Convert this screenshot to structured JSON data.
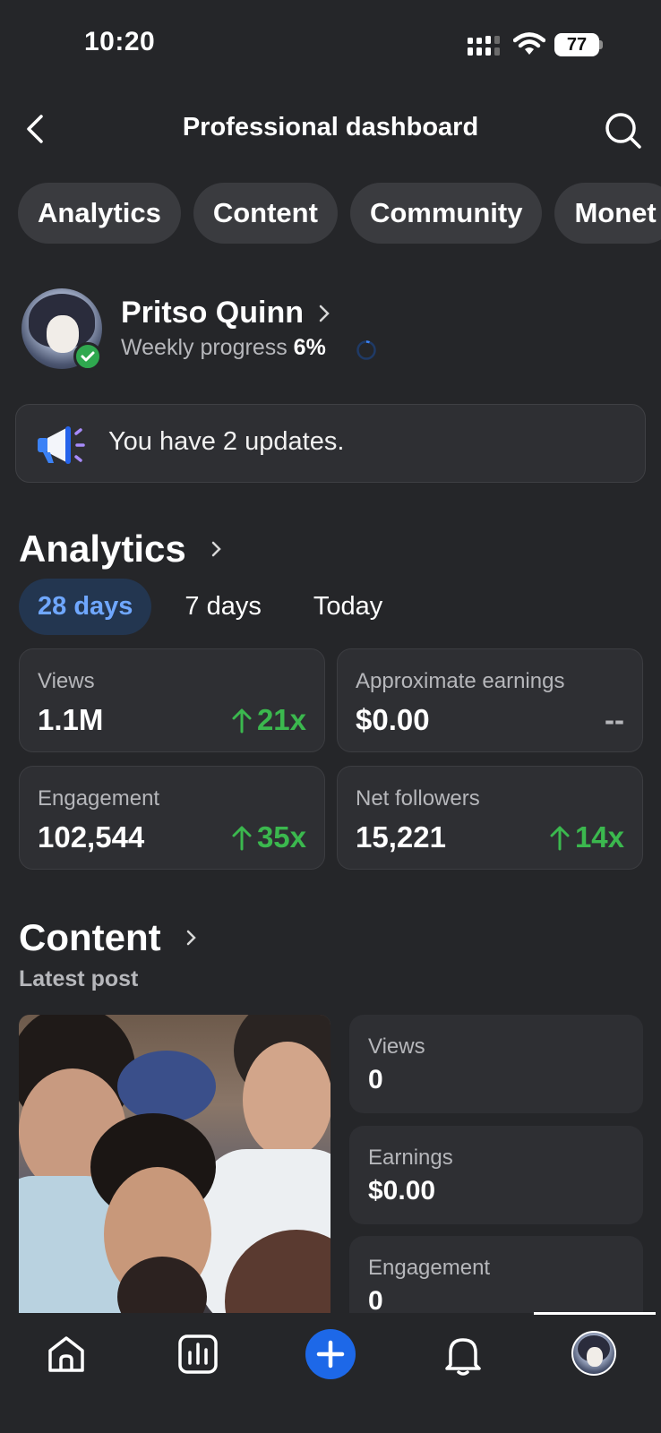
{
  "status_bar": {
    "time": "10:20",
    "battery": "77"
  },
  "header": {
    "title": "Professional dashboard"
  },
  "tabs": [
    {
      "label": "Analytics"
    },
    {
      "label": "Content"
    },
    {
      "label": "Community"
    },
    {
      "label": "Monet"
    }
  ],
  "profile": {
    "name": "Pritso Quinn",
    "progress_label": "Weekly progress",
    "progress_value": "6%"
  },
  "banner": {
    "text": "You have 2 updates."
  },
  "analytics": {
    "title": "Analytics",
    "ranges": [
      {
        "label": "28 days",
        "active": true
      },
      {
        "label": "7 days",
        "active": false
      },
      {
        "label": "Today",
        "active": false
      }
    ],
    "cards": [
      {
        "label": "Views",
        "value": "1.1M",
        "delta": "21x"
      },
      {
        "label": "Approximate earnings",
        "value": "$0.00",
        "delta": "--"
      },
      {
        "label": "Engagement",
        "value": "102,544",
        "delta": "35x"
      },
      {
        "label": "Net followers",
        "value": "15,221",
        "delta": "14x"
      }
    ]
  },
  "content": {
    "title": "Content",
    "subtitle": "Latest post",
    "stats": [
      {
        "label": "Views",
        "value": "0"
      },
      {
        "label": "Earnings",
        "value": "$0.00"
      },
      {
        "label": "Engagement",
        "value": "0"
      }
    ]
  },
  "colors": {
    "background": "#252629",
    "card": "#2e2f33",
    "accent_blue": "#1d68e8",
    "positive_green": "#3bb84e",
    "active_range_text": "#6fa7ff"
  },
  "icons": [
    "back-chevron-icon",
    "search-icon",
    "verified-check-icon",
    "megaphone-icon",
    "home-icon",
    "analytics-icon",
    "compose-plus-icon",
    "notifications-bell-icon"
  ]
}
